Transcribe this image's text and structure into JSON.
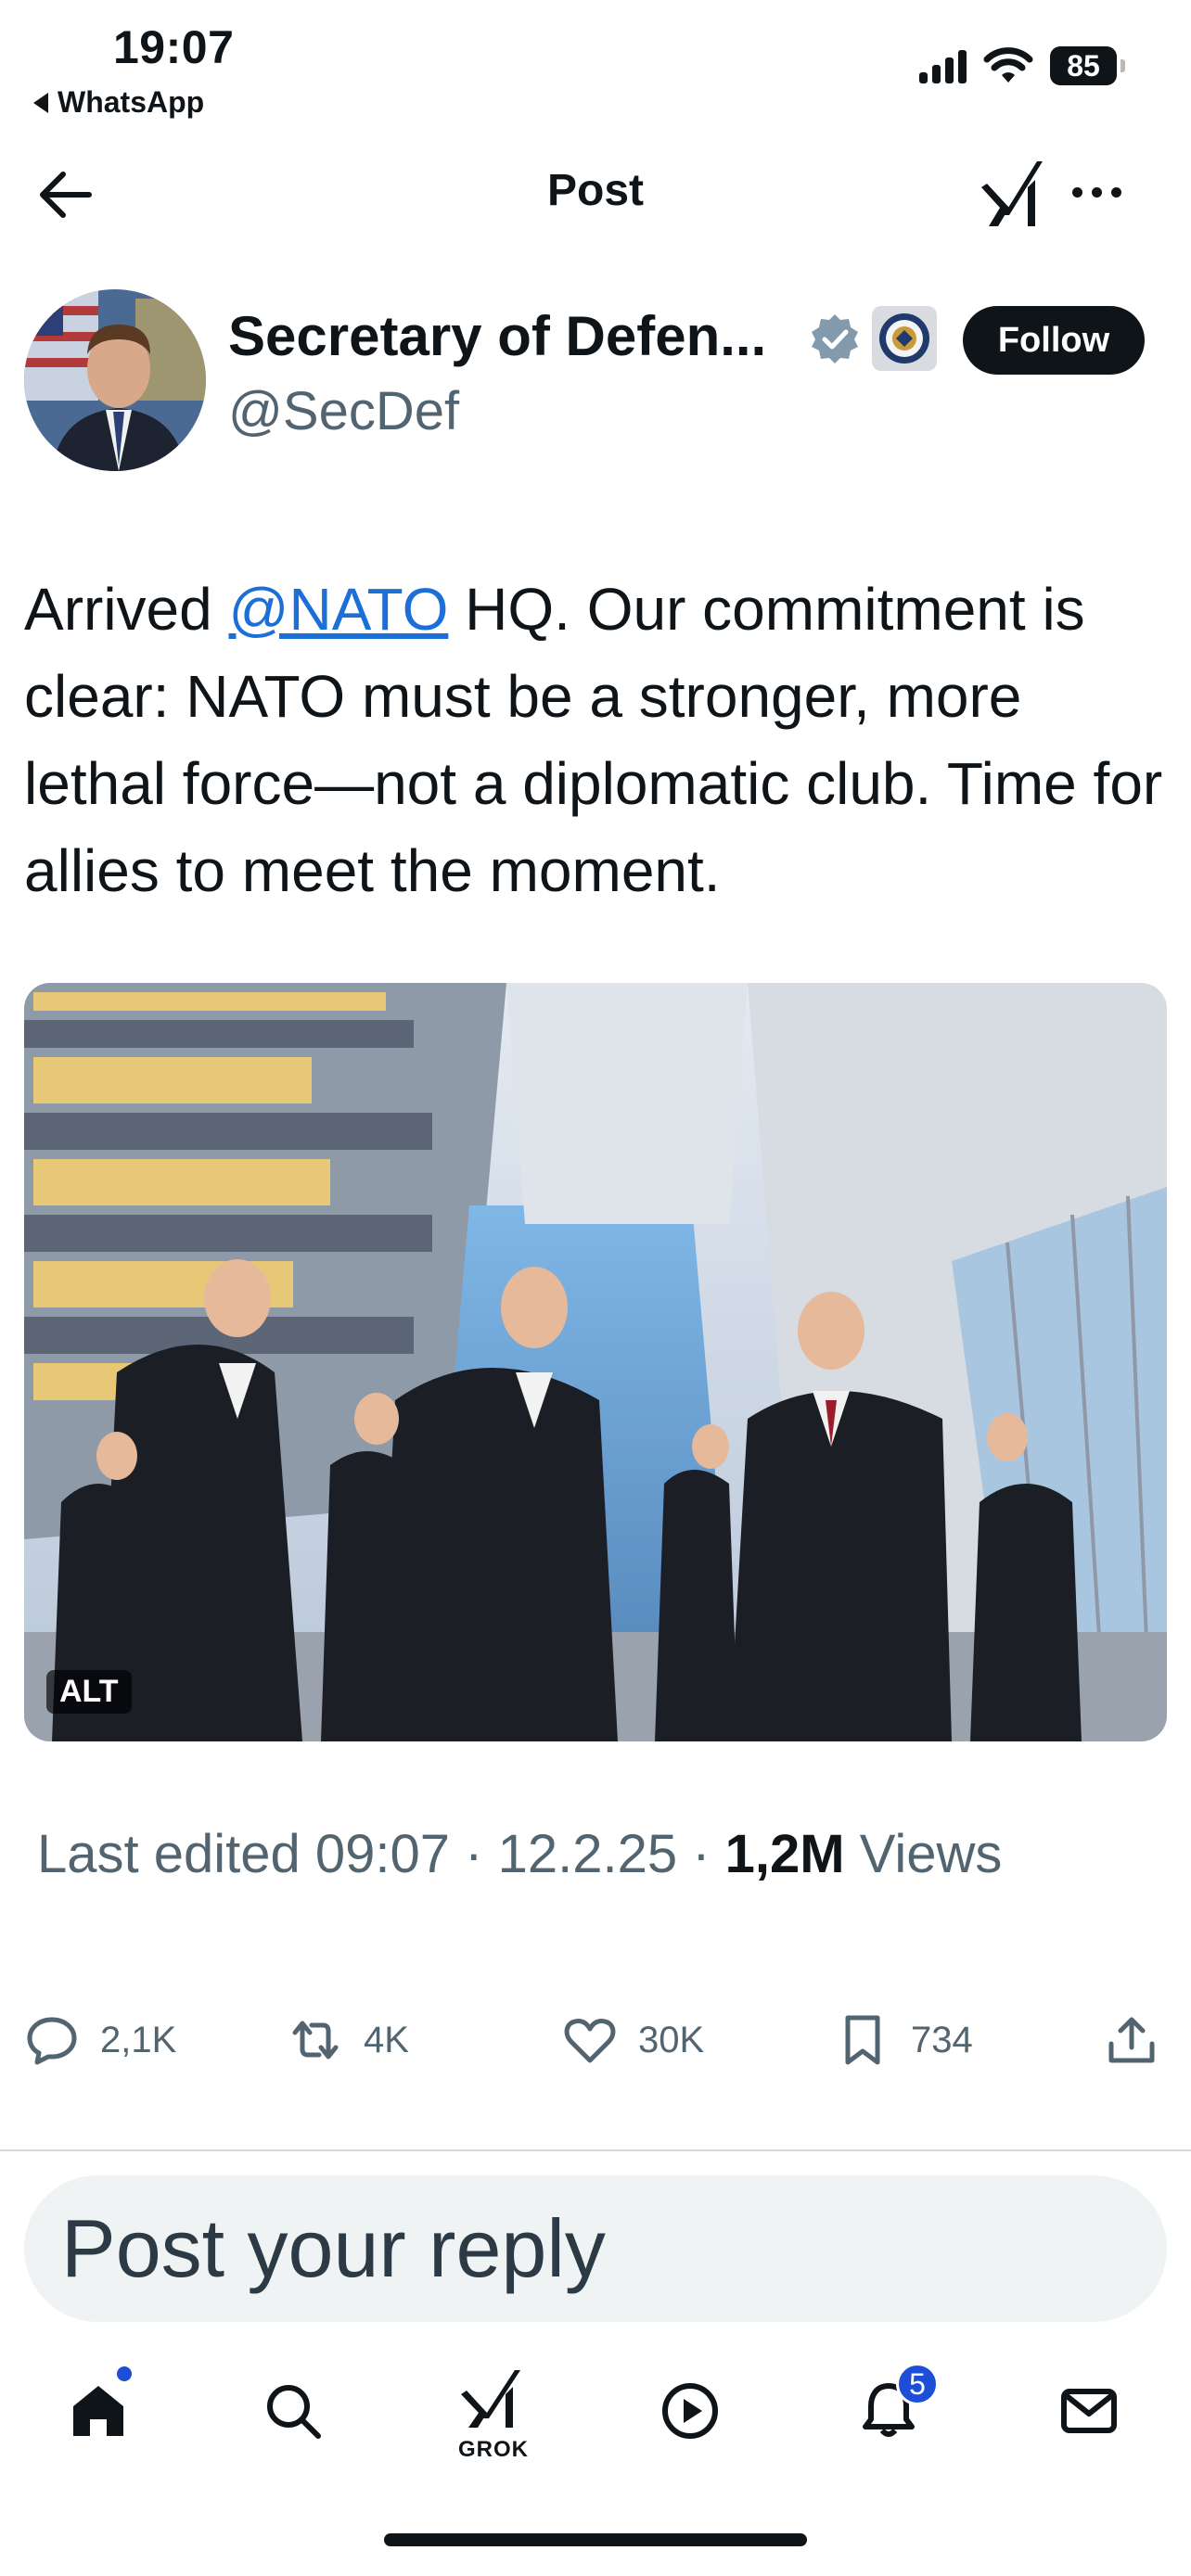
{
  "status_bar": {
    "time": "19:07",
    "back_app": "WhatsApp",
    "battery": "85"
  },
  "header": {
    "title": "Post"
  },
  "author": {
    "name": "Secretary of Defen...",
    "handle": "@SecDef",
    "follow_label": "Follow"
  },
  "post": {
    "text_before": "Arrived ",
    "mention": "@NATO",
    "text_after": " HQ. Our commitment is clear: NATO must be a stronger, more lethal force—not a diplomatic club. Time for allies to meet the moment.",
    "media_alt_label": "ALT"
  },
  "meta": {
    "edited": "Last edited 09:07 · 12.2.25 ",
    "separator": " · ",
    "views_count": "1,2M",
    "views_label": " Views"
  },
  "actions": {
    "replies": "2,1K",
    "reposts": "4K",
    "likes": "30K",
    "bookmarks": "734"
  },
  "reply": {
    "placeholder": "Post your reply"
  },
  "tabbar": {
    "grok_label": "GROK",
    "notifications_count": "5"
  },
  "colors": {
    "accent": "#1d9bf0",
    "mention": "#1d6fd8",
    "secondary_text": "#536471",
    "badge_blue": "#1d4ed8"
  }
}
